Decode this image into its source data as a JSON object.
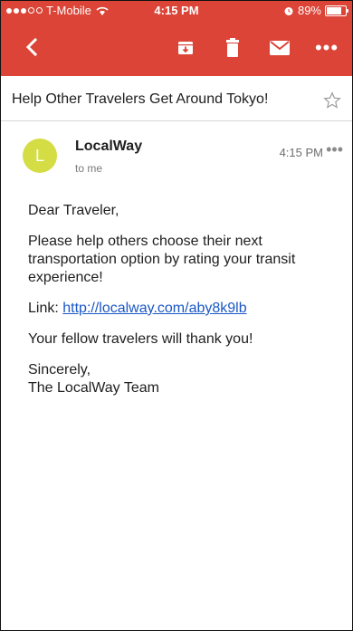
{
  "status": {
    "carrier": "T-Mobile",
    "time": "4:15 PM",
    "battery": "89%"
  },
  "toolbar": {
    "more_label": "•••"
  },
  "subject": {
    "title": "Help Other Travelers Get Around Tokyo!"
  },
  "sender": {
    "name": "LocalWay",
    "initial": "L",
    "to": "to me",
    "time": "4:15 PM",
    "more": "•••"
  },
  "email": {
    "greeting": "Dear Traveler,",
    "paragraph1": "Please help others choose their next transportation option by rating your transit experience!",
    "link_label": "Link:",
    "link_url": "http://localway.com/aby8k9lb",
    "thanks": "Your fellow travelers will thank you!",
    "signoff_line1": "Sincerely,",
    "signoff_line2": "The LocalWay Team"
  },
  "colors": {
    "header": "#db4437",
    "avatar": "#d4dd43",
    "link": "#1a57c5"
  },
  "icons": [
    "back-icon",
    "archive-icon",
    "trash-icon",
    "mail-icon",
    "more-icon",
    "star-icon",
    "wifi-icon",
    "alarm-icon",
    "battery-icon"
  ]
}
